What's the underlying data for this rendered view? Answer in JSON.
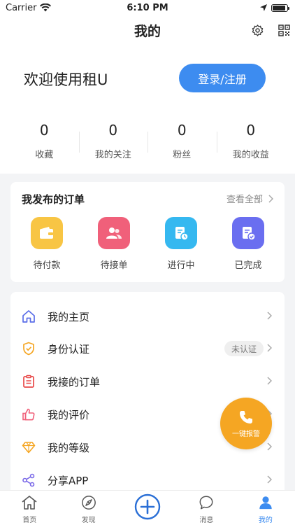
{
  "status_bar": {
    "carrier": "Carrier",
    "time": "6:10 PM",
    "battery_level": 0.9
  },
  "nav": {
    "title": "我的",
    "icons": [
      "gear-icon",
      "qr-code-icon"
    ]
  },
  "profile": {
    "welcome": "欢迎使用租U",
    "login_label": "登录/注册",
    "stats": [
      {
        "value": "0",
        "label": "收藏"
      },
      {
        "value": "0",
        "label": "我的关注"
      },
      {
        "value": "0",
        "label": "粉丝"
      },
      {
        "value": "0",
        "label": "我的收益"
      }
    ]
  },
  "orders": {
    "title": "我发布的订单",
    "view_all": "查看全部",
    "items": [
      {
        "label": "待付款",
        "icon": "wallet-icon",
        "color": "#f8c544"
      },
      {
        "label": "待接单",
        "icon": "users-icon",
        "color": "#f0607a"
      },
      {
        "label": "进行中",
        "icon": "clock-document-icon",
        "color": "#35b8f0"
      },
      {
        "label": "已完成",
        "icon": "check-document-icon",
        "color": "#6a6ef0"
      }
    ]
  },
  "menu": {
    "items": [
      {
        "label": "我的主页",
        "icon": "home-icon",
        "color": "#5b6ee8"
      },
      {
        "label": "身份认证",
        "icon": "shield-check-icon",
        "color": "#f5a623",
        "badge": "未认证"
      },
      {
        "label": "我接的订单",
        "icon": "clipboard-icon",
        "color": "#e84a4a"
      },
      {
        "label": "我的评价",
        "icon": "thumbs-up-icon",
        "color": "#f0607a"
      },
      {
        "label": "我的等级",
        "icon": "diamond-icon",
        "color": "#f5a623"
      },
      {
        "label": "分享APP",
        "icon": "share-icon",
        "color": "#7b6ae8"
      }
    ]
  },
  "fab": {
    "label": "一键报警",
    "icon": "phone-icon",
    "color": "#f5a623"
  },
  "tab_bar": {
    "tabs": [
      {
        "label": "首页",
        "icon": "home-icon"
      },
      {
        "label": "发现",
        "icon": "compass-icon"
      },
      {
        "label": "",
        "icon": "plus-circle-icon"
      },
      {
        "label": "消息",
        "icon": "chat-bubble-icon"
      },
      {
        "label": "我的",
        "icon": "user-icon",
        "active": true
      }
    ],
    "active_color": "#3d8cf0"
  }
}
